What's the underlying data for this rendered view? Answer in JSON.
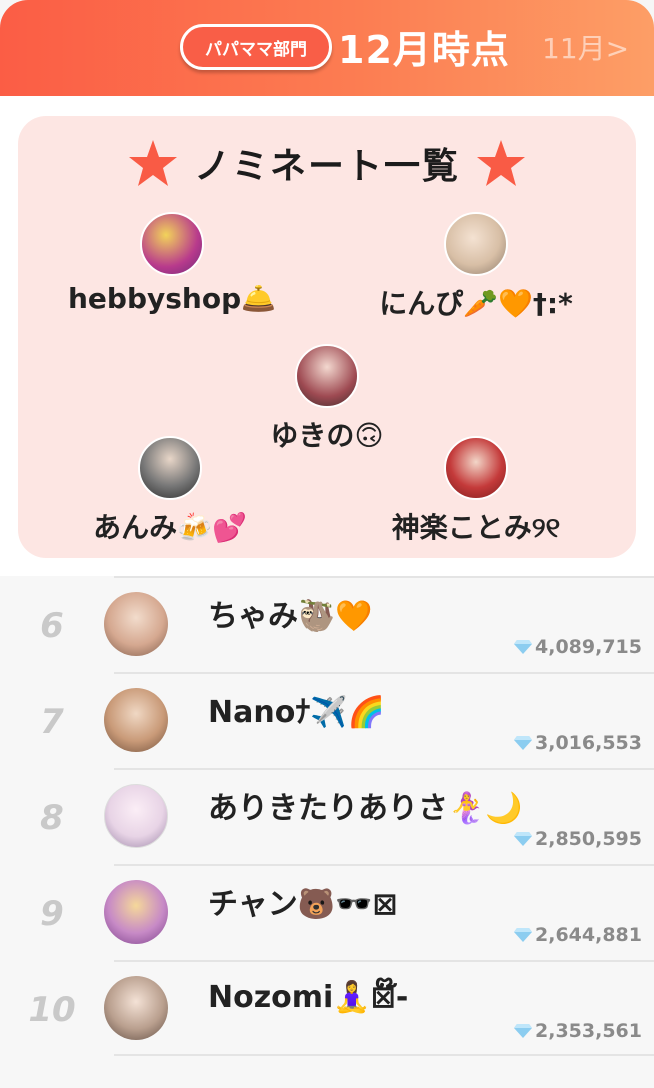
{
  "header": {
    "department_badge": "パパママ部門",
    "title": "12月時点",
    "prev_month": "11月>"
  },
  "colors": {
    "header_gradient_start": "#fb5d45",
    "header_gradient_end": "#fd9e66",
    "panel_bg": "#fde6e3",
    "star": "#f95b45",
    "rank_number": "#c9c9c9",
    "gem": "#8ccdf0"
  },
  "nominees": {
    "title": "ノミネート一覧",
    "items": [
      {
        "name": "hebbyshop🛎️",
        "avatar_color": "#b83a8c"
      },
      {
        "name": "にんぴ🥕🧡†:*",
        "avatar_color": "#d8bfa6"
      },
      {
        "name": "ゆきの🙃",
        "avatar_color": "#9e4a52"
      },
      {
        "name": "あんみ🍻💕",
        "avatar_color": "#2a2a2a"
      },
      {
        "name": "神楽ことみ୨୧",
        "avatar_color": "#c43a3a"
      }
    ]
  },
  "ranking": [
    {
      "rank": "6",
      "name": "ちゃみ🦥🧡",
      "points": "4,089,715",
      "avatar_color": "#d5a890"
    },
    {
      "rank": "7",
      "name": "Nanoﾅ✈️🌈",
      "points": "3,016,553",
      "avatar_color": "#c99a78"
    },
    {
      "rank": "8",
      "name": "ありきたりありさ🧜‍♀️🌙",
      "points": "2,850,595",
      "avatar_color": "#e8d4e6"
    },
    {
      "rank": "9",
      "name": "チャン🐻🕶️⊠",
      "points": "2,644,881",
      "avatar_color": "#c78ac6"
    },
    {
      "rank": "10",
      "name": "Nozomi🧘‍♀️⊠໊-",
      "points": "2,353,561",
      "avatar_color": "#b99f8e"
    }
  ]
}
